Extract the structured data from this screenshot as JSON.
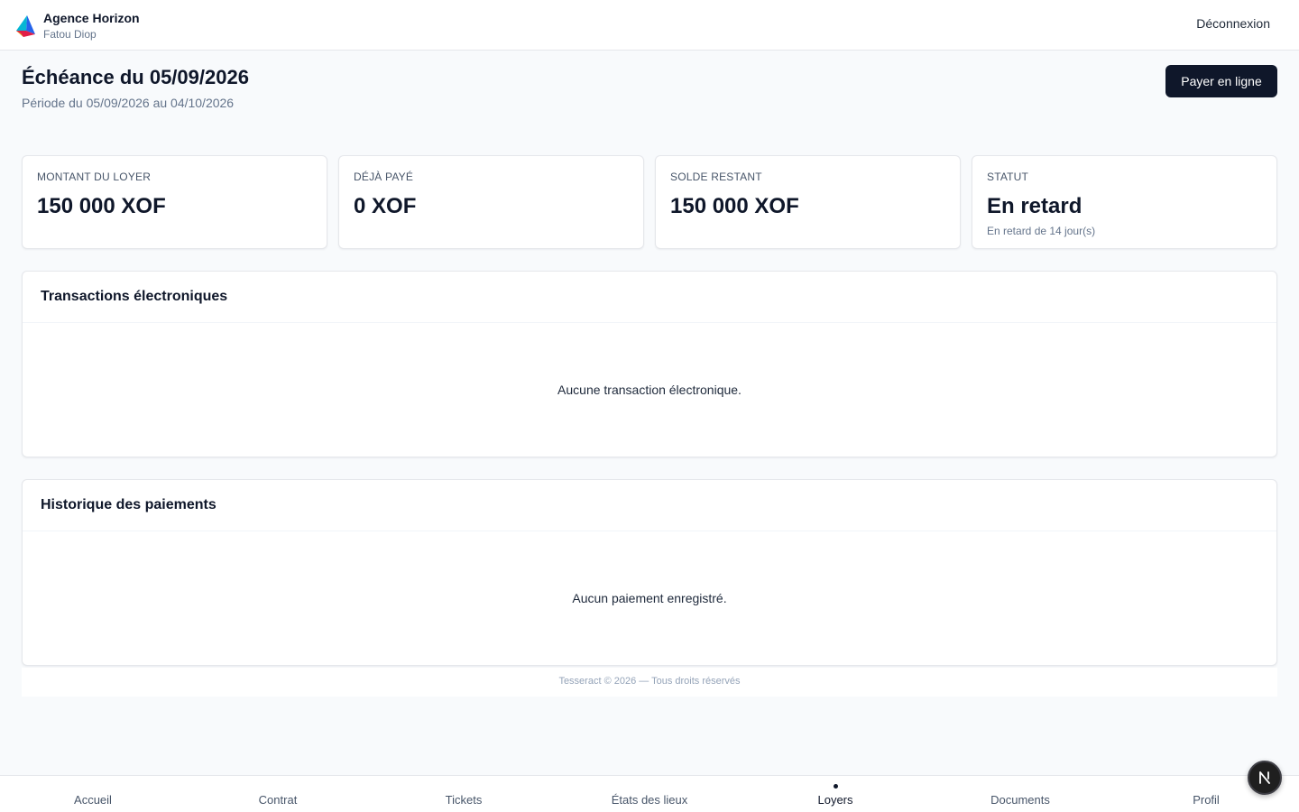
{
  "header": {
    "agency_name": "Agence Horizon",
    "user_name": "Fatou Diop",
    "logout_label": "Déconnexion"
  },
  "page": {
    "title": "Échéance du 05/09/2026",
    "subtitle": "Période du 05/09/2026 au 04/10/2026",
    "pay_button_label": "Payer en ligne"
  },
  "stats": [
    {
      "label": "MONTANT DU LOYER",
      "value": "150 000 XOF"
    },
    {
      "label": "DÉJÀ PAYÉ",
      "value": "0 XOF"
    },
    {
      "label": "SOLDE RESTANT",
      "value": "150 000 XOF"
    },
    {
      "label": "STATUT",
      "value": "En retard",
      "note": "En retard de 14 jour(s)"
    }
  ],
  "transactions": {
    "title": "Transactions électroniques",
    "empty_message": "Aucune transaction électronique."
  },
  "payments": {
    "title": "Historique des paiements",
    "empty_message": "Aucun paiement enregistré."
  },
  "footer": {
    "text": "Tesseract © 2026 — Tous droits réservés"
  },
  "bottom_nav": {
    "active": "Loyers",
    "items": [
      "Accueil",
      "Contrat",
      "Tickets",
      "États des lieux",
      "Loyers",
      "Documents",
      "Profil"
    ]
  },
  "dev_badge": {
    "label": "N"
  },
  "colors": {
    "primary": "#0f172a",
    "background": "#f8fafc",
    "muted": "#64748b",
    "border": "#e5e7eb"
  },
  "icons": {
    "logo": "agency-logo-icon",
    "dev_badge": "next-logo-icon"
  }
}
